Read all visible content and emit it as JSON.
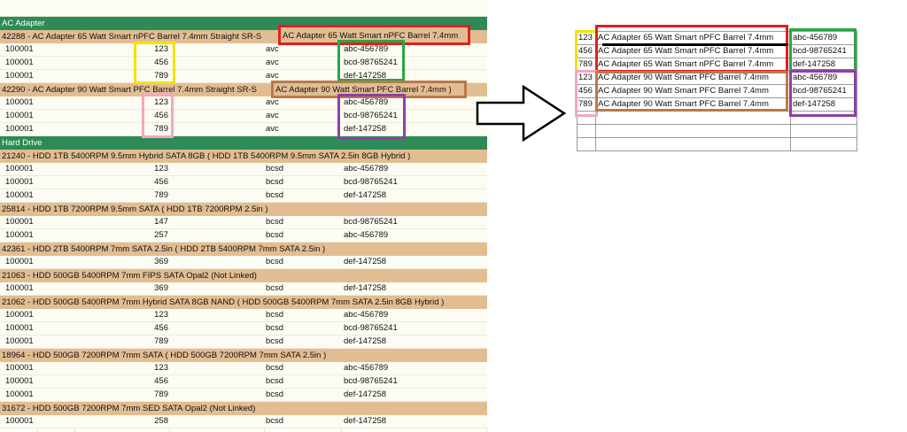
{
  "sheet": {
    "sections": [
      {
        "category": "AC Adapter",
        "products": [
          {
            "title": "42288 - AC Adapter 65 Watt Smart nPFC Barrel 7.4mm Straight SR-S",
            "overlay": "AC Adapter 65 Watt Smart nPFC Barrel 7.4mm",
            "rows": [
              [
                "100001",
                "123",
                "avc",
                "abc-456789"
              ],
              [
                "100001",
                "456",
                "avc",
                "bcd-98765241"
              ],
              [
                "100001",
                "789",
                "avc",
                "def-147258"
              ]
            ]
          },
          {
            "title": "42290 - AC Adapter 90 Watt Smart PFC Barrel 7.4mm Straight SR-S",
            "overlay": "AC Adapter 90 Watt Smart PFC Barrel 7.4mm )",
            "rows": [
              [
                "100001",
                "123",
                "avc",
                "abc-456789"
              ],
              [
                "100001",
                "456",
                "avc",
                "bcd-98765241"
              ],
              [
                "100001",
                "789",
                "avc",
                "def-147258"
              ]
            ]
          }
        ]
      },
      {
        "category": "Hard Drive",
        "products": [
          {
            "title": "21240 - HDD 1TB 5400RPM 9.5mm Hybrid SATA 8GB ( HDD 1TB 5400RPM 9.5mm SATA 2.5in 8GB Hybrid )",
            "rows": [
              [
                "100001",
                "123",
                "bcsd",
                "abc-456789"
              ],
              [
                "100001",
                "456",
                "bcsd",
                "bcd-98765241"
              ],
              [
                "100001",
                "789",
                "bcsd",
                "def-147258"
              ]
            ]
          },
          {
            "title": "25814 - HDD 1TB 7200RPM 9.5mm SATA ( HDD 1TB 7200RPM 2.5in )",
            "rows": [
              [
                "100001",
                "147",
                "bcsd",
                "bcd-98765241"
              ],
              [
                "100001",
                "257",
                "bcsd",
                "abc-456789"
              ]
            ]
          },
          {
            "title": "42361 - HDD 2TB 5400RPM 7mm SATA 2.5in ( HDD 2TB 5400RPM 7mm SATA 2.5in )",
            "rows": [
              [
                "100001",
                "369",
                "bcsd",
                "def-147258"
              ]
            ]
          },
          {
            "title": "21063 - HDD 500GB 5400RPM 7mm FIPS SATA Opal2 (Not Linked)",
            "rows": [
              [
                "100001",
                "369",
                "bcsd",
                "def-147258"
              ]
            ]
          },
          {
            "title": "21062 - HDD 500GB 5400RPM 7mm Hybrid SATA 8GB NAND ( HDD 500GB 5400RPM 7mm SATA 2.5in 8GB Hybrid )",
            "rows": [
              [
                "100001",
                "123",
                "bcsd",
                "abc-456789"
              ],
              [
                "100001",
                "456",
                "bcsd",
                "bcd-98765241"
              ],
              [
                "100001",
                "789",
                "bcsd",
                "def-147258"
              ]
            ]
          },
          {
            "title": "18964 - HDD 500GB 7200RPM 7mm SATA ( HDD 500GB 7200RPM 7mm SATA 2.5in )",
            "rows": [
              [
                "100001",
                "123",
                "bcsd",
                "abc-456789"
              ],
              [
                "100001",
                "456",
                "bcsd",
                "bcd-98765241"
              ],
              [
                "100001",
                "789",
                "bcsd",
                "def-147258"
              ]
            ]
          },
          {
            "title": "31672 - HDD 500GB 7200RPM 7mm SED SATA Opal2 (Not Linked)",
            "rows": [
              [
                "100001",
                "258",
                "bcsd",
                "def-147258"
              ]
            ]
          }
        ]
      }
    ]
  },
  "result": {
    "rows": [
      [
        "123",
        "AC Adapter 65 Watt Smart nPFC Barrel 7.4mm",
        "abc-456789"
      ],
      [
        "456",
        "AC Adapter 65 Watt Smart nPFC Barrel 7.4mm",
        "bcd-98765241"
      ],
      [
        "789",
        "AC Adapter 65 Watt Smart nPFC Barrel 7.4mm",
        "def-147258"
      ],
      [
        "123",
        "AC Adapter 90 Watt Smart PFC Barrel 7.4mm",
        "abc-456789"
      ],
      [
        "456",
        "AC Adapter 90 Watt Smart PFC Barrel 7.4mm",
        "bcd-98765241"
      ],
      [
        "789",
        "AC Adapter 90 Watt Smart PFC Barrel 7.4mm",
        "def-147258"
      ],
      [
        "",
        "",
        ""
      ],
      [
        "",
        "",
        ""
      ],
      [
        "",
        "",
        ""
      ]
    ]
  },
  "colors": {
    "category_bg": "#2e8b57",
    "product_bg": "#e3bd92",
    "row_bg": "#fcfcf2",
    "highlight_red": "#e02020",
    "highlight_yellow": "#f2e400",
    "highlight_green": "#28a745",
    "highlight_brown": "#b87a4b",
    "highlight_pink": "#f4a6bd",
    "highlight_purple": "#8e3fa8",
    "highlight_black": "#000000"
  },
  "icons": {
    "arrow": "right-arrow-icon"
  }
}
